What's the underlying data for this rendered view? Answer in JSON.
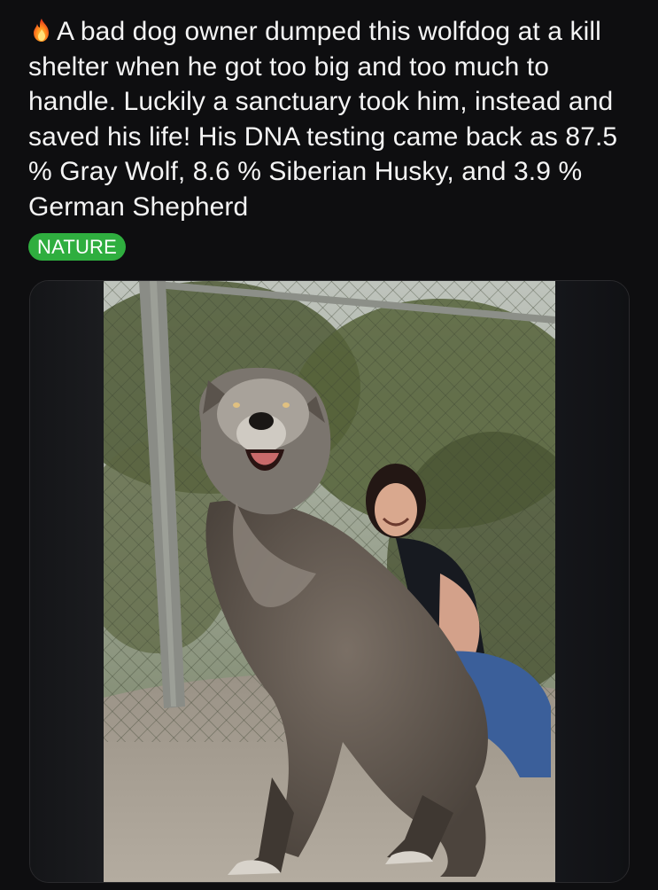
{
  "post": {
    "icon": "fire-icon",
    "text": "A bad dog owner dumped this wolfdog at a kill shelter when he got too big and too much to handle. Luckily a sanctuary took him, instead and saved his life! His DNA testing came back as 87.5 % Gray Wolf, 8.6 % Siberian Husky, and 3.9 % German Shepherd",
    "tag": "NATURE",
    "tag_color": "#2fae3f"
  },
  "colors": {
    "background": "#0e0e10",
    "text": "#f4f4f4"
  }
}
